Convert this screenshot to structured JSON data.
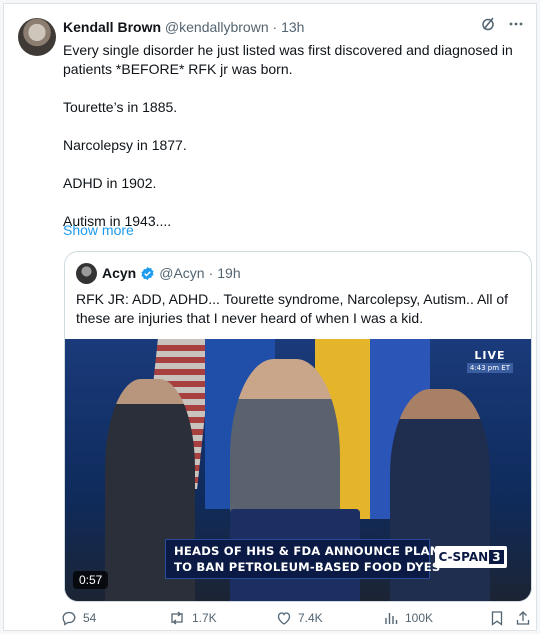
{
  "tweet": {
    "author_name": "Kendall Brown",
    "author_handle": "@kendallybrown",
    "separator": "·",
    "time": "13h",
    "paragraphs": [
      "Every single disorder he just listed was first discovered and diagnosed in patients *BEFORE* RFK jr was born.",
      "Tourette’s in 1885.",
      "Narcolepsy in 1877.",
      "ADHD in 1902.",
      "Autism in 1943...."
    ],
    "show_more": "Show more",
    "icons": {
      "grok": "grok-icon",
      "more": "more-icon"
    }
  },
  "quote": {
    "author_name": "Acyn",
    "author_handle": "@Acyn",
    "separator": "·",
    "time": "19h",
    "verified": true,
    "verified_color": "#1d9bf0",
    "text": "RFK JR: ADD, ADHD... Tourette syndrome, Narcolepsy, Autism.. All of these are injuries that I never heard of when I was a kid.",
    "video": {
      "live_label": "LIVE",
      "live_time": "4:43 pm ET",
      "chyron_line1": "HEADS OF HHS & FDA ANNOUNCE PLAN",
      "chyron_line2": "TO BAN PETROLEUM-BASED FOOD DYES",
      "network": "C-SPAN",
      "network_num": "3",
      "duration": "0:57"
    }
  },
  "actions": {
    "replies": "54",
    "reposts": "1.7K",
    "likes": "7.4K",
    "views": "100K"
  },
  "colors": {
    "accent": "#1d9bf0",
    "muted": "#536471",
    "text": "#0f1419"
  }
}
